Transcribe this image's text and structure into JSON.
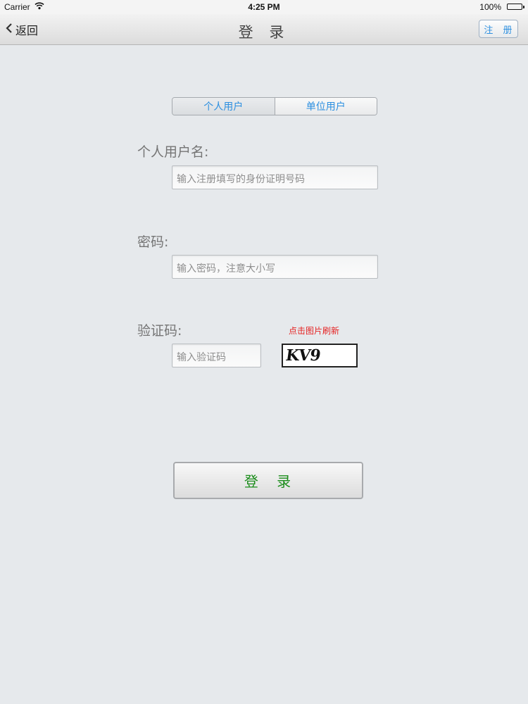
{
  "status_bar": {
    "carrier": "Carrier",
    "time": "4:25 PM",
    "battery": "100%",
    "battery_level": 1.0
  },
  "nav": {
    "back_label": "返回",
    "title": "登 录",
    "register_label": "注 册"
  },
  "segment": {
    "items": [
      {
        "label": "个人用户",
        "selected": true
      },
      {
        "label": "单位用户",
        "selected": false
      }
    ]
  },
  "form": {
    "username_label": "个人用户名:",
    "username_placeholder": "输入注册填写的身份证明号码",
    "password_label": "密码:",
    "password_placeholder": "输入密码，注意大小写",
    "captcha_label": "验证码:",
    "captcha_placeholder": "输入验证码",
    "captcha_refresh_hint": "点击图片刷新",
    "captcha_text": "KV9"
  },
  "login_button_label": "登 录",
  "colors": {
    "accent": "#2c8fe0",
    "login_text": "#1a8c1a",
    "hint": "#e52222"
  }
}
